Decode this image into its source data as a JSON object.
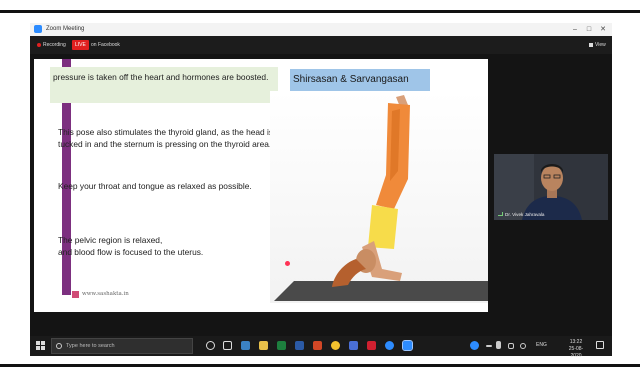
{
  "window": {
    "title": "Zoom Meeting",
    "minimize": "–",
    "maximize": "□",
    "close": "✕"
  },
  "toolbar": {
    "recording_label": "Recording",
    "live_label": "LIVE",
    "live_on": "on Facebook",
    "view_label": "View"
  },
  "slide": {
    "green_text": "pressure is taken off the heart and hormones are boosted.",
    "title": "Shirsasan & Sarvangasan",
    "para1": "This pose also stimulates the thyroid gland, as the head is tucked in and the sternum is pressing on the thyroid area.",
    "para2": "Keep your throat and tongue as relaxed as possible.",
    "para3_line1": "The pelvic region is relaxed,",
    "para3_line2": "and blood flow is focused to the uterus.",
    "watermark": "www.sashakta.in"
  },
  "participant": {
    "name": "Dr. Vivek Jahravala"
  },
  "taskbar": {
    "search_placeholder": "Type here to search",
    "time": "13:22",
    "date": "25-08-2020",
    "lang": "ENG"
  },
  "colors": {
    "accent": "#2d8cff",
    "live": "#e02020",
    "slide_bar": "#7c2f7f",
    "title_box": "#9fc5e8",
    "green_box": "#e6f0dc"
  }
}
